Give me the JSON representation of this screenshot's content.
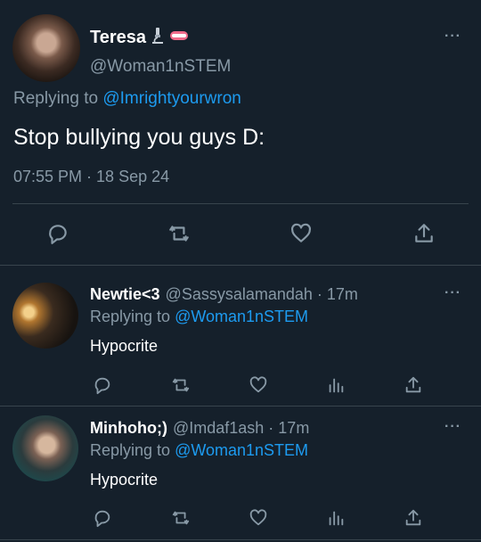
{
  "main": {
    "name": "Teresa",
    "handle": "@Woman1nSTEM",
    "replying_prefix": "Replying to ",
    "replying_to": "@Imrightyourwron",
    "text": "Stop bullying you guys D:",
    "timestamp": "07:55 PM · 18 Sep 24",
    "more": "···"
  },
  "replies": [
    {
      "name": "Newtie<3",
      "handle": "@Sassysalamandah",
      "time": "· 17m",
      "replying_prefix": "Replying to ",
      "replying_to": "@Woman1nSTEM",
      "text": "Hypocrite",
      "more": "···"
    },
    {
      "name": "Minhoho;)",
      "handle": "@Imdaf1ash",
      "time": "· 17m",
      "replying_prefix": "Replying to ",
      "replying_to": "@Woman1nSTEM",
      "text": "Hypocrite",
      "more": "···"
    }
  ],
  "colors": {
    "background": "#15202b",
    "muted": "#8899a6",
    "link": "#1d9bf0",
    "divider": "#38444d"
  },
  "icons": {
    "main_actions": [
      "reply-icon",
      "retweet-icon",
      "like-icon",
      "share-icon"
    ],
    "reply_actions": [
      "reply-icon",
      "retweet-icon",
      "like-icon",
      "analytics-icon",
      "share-icon"
    ]
  }
}
